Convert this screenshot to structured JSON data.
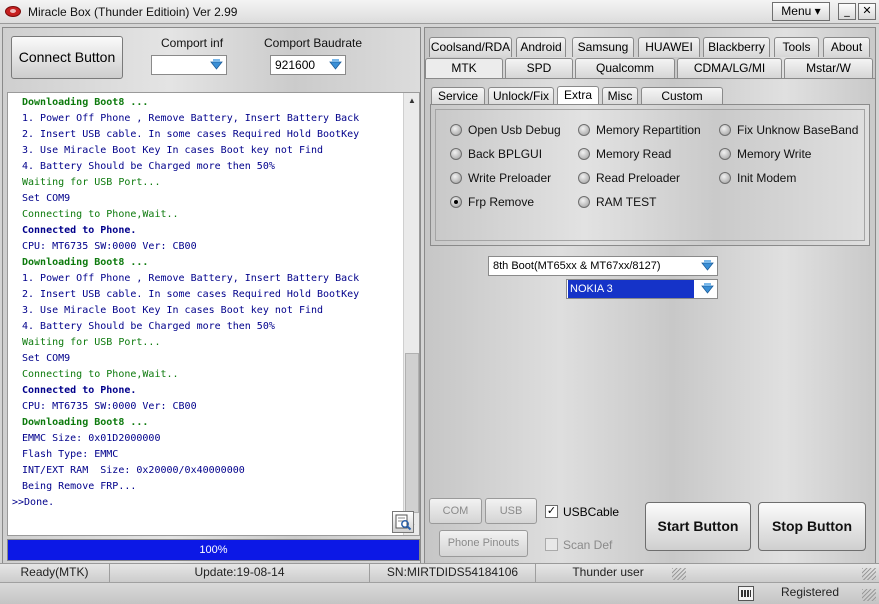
{
  "window": {
    "title": "Miracle Box (Thunder Editioin) Ver 2.99",
    "menu_label": "Menu",
    "minimize": "_",
    "maximize": "□",
    "close": "✕"
  },
  "left": {
    "connect_label": "Connect Button",
    "comport_label": "Comport inf",
    "comport_value": "",
    "baud_label": "Comport Baudrate",
    "baud_value": "921600",
    "log": [
      {
        "text": "Downloading Boot8 ...",
        "color": "green",
        "bold": true
      },
      {
        "text": "1. Power Off Phone , Remove Battery, Insert Battery Back",
        "color": "blue",
        "bold": false
      },
      {
        "text": "2. Insert USB cable. In some cases Required Hold BootKey",
        "color": "blue",
        "bold": false
      },
      {
        "text": "3. Use Miracle Boot Key In cases Boot key not Find",
        "color": "blue",
        "bold": false
      },
      {
        "text": "4. Battery Should be Charged more then 50%",
        "color": "blue",
        "bold": false
      },
      {
        "text": "Waiting for USB Port...",
        "color": "green",
        "bold": false
      },
      {
        "text": "Set COM9",
        "color": "blue",
        "bold": false
      },
      {
        "text": "Connecting to Phone,Wait..",
        "color": "green",
        "bold": false
      },
      {
        "text": "Connected to Phone.",
        "color": "blue",
        "bold": true
      },
      {
        "text": "CPU: MT6735 SW:0000 Ver: CB00",
        "color": "blue",
        "bold": false
      },
      {
        "text": "Downloading Boot8 ...",
        "color": "green",
        "bold": true
      },
      {
        "text": "1. Power Off Phone , Remove Battery, Insert Battery Back",
        "color": "blue",
        "bold": false
      },
      {
        "text": "2. Insert USB cable. In some cases Required Hold BootKey",
        "color": "blue",
        "bold": false
      },
      {
        "text": "3. Use Miracle Boot Key In cases Boot key not Find",
        "color": "blue",
        "bold": false
      },
      {
        "text": "4. Battery Should be Charged more then 50%",
        "color": "blue",
        "bold": false
      },
      {
        "text": "Waiting for USB Port...",
        "color": "green",
        "bold": false
      },
      {
        "text": "Set COM9",
        "color": "blue",
        "bold": false
      },
      {
        "text": "Connecting to Phone,Wait..",
        "color": "green",
        "bold": false
      },
      {
        "text": "Connected to Phone.",
        "color": "blue",
        "bold": true
      },
      {
        "text": "CPU: MT6735 SW:0000 Ver: CB00",
        "color": "blue",
        "bold": false
      },
      {
        "text": "Downloading Boot8 ...",
        "color": "green",
        "bold": true
      },
      {
        "text": "EMMC Size: 0x01D2000000",
        "color": "blue",
        "bold": false
      },
      {
        "text": "Flash Type: EMMC",
        "color": "blue",
        "bold": false
      },
      {
        "text": "INT/EXT RAM  Size: 0x20000/0x40000000",
        "color": "blue",
        "bold": false
      },
      {
        "text": "Being Remove FRP...",
        "color": "blue",
        "bold": false
      },
      {
        "text": ">>Done.",
        "color": "blue",
        "bold": false
      }
    ],
    "progress_label": "100%",
    "progress": 1.0
  },
  "right": {
    "tabs_row1": [
      "Coolsand/RDA",
      "Android",
      "Samsung",
      "HUAWEI",
      "Blackberry",
      "Tools",
      "About"
    ],
    "tabs_row2": [
      "MTK",
      "SPD",
      "Qualcomm",
      "CDMA/LG/MI",
      "Mstar/W"
    ],
    "subtabs": [
      "Service",
      "Unlock/Fix",
      "Extra",
      "Misc",
      "Custom Setting"
    ],
    "active_subtab": "Extra",
    "options": [
      {
        "label": "Open Usb Debug",
        "checked": false
      },
      {
        "label": "Back BPLGUI",
        "checked": false
      },
      {
        "label": "Write Preloader",
        "checked": false
      },
      {
        "label": "Frp Remove",
        "checked": true
      },
      {
        "label": "Memory Repartition",
        "checked": false
      },
      {
        "label": "Memory Read",
        "checked": false
      },
      {
        "label": "Read Preloader",
        "checked": false
      },
      {
        "label": "RAM TEST",
        "checked": false
      },
      {
        "label": "Fix Unknow BaseBand",
        "checked": false
      },
      {
        "label": "Memory Write",
        "checked": false
      },
      {
        "label": "Init Modem",
        "checked": false
      }
    ],
    "boot_select": "8th Boot(MT65xx & MT67xx/8127)",
    "model_select": "NOKIA 3",
    "com_scan": "COM Scan",
    "usb_scan": "USB Scan",
    "usb_cable": "USBCable",
    "phone_pinouts": "Phone Pinouts",
    "scan_def": "Scan Def",
    "start": "Start Button",
    "stop": "Stop Button"
  },
  "status": {
    "mode": "Ready(MTK)",
    "update": "Update:19-08-14",
    "sn": "SN:MIRTDIDS54184106",
    "user": "Thunder user",
    "registered": "Registered"
  }
}
